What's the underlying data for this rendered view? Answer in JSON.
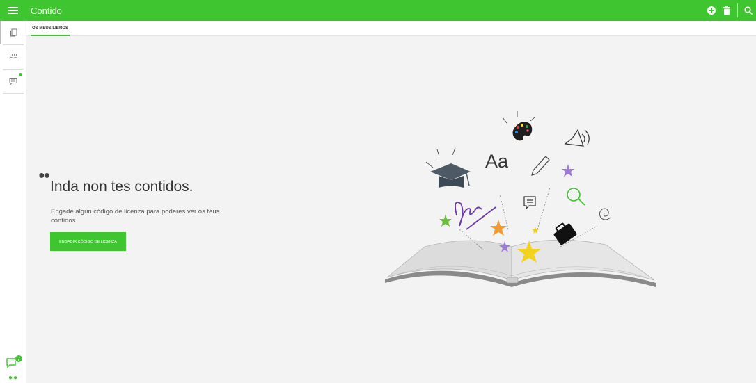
{
  "header": {
    "title": "Contido",
    "menu_icon": "menu-icon",
    "actions": [
      "add-icon",
      "trash-icon",
      "search-icon"
    ]
  },
  "tabs": [
    {
      "label": "OS MEUS LIBROS"
    }
  ],
  "sidebar": {
    "items": [
      {
        "icon": "books-icon"
      },
      {
        "icon": "groups-icon"
      },
      {
        "icon": "messages-icon"
      }
    ],
    "chat_badge": "7"
  },
  "empty_state": {
    "title": "Inda non tes contidos.",
    "description": "Engade algún código de licenza para poderes ver os teus contidos.",
    "button_label": "ENGADIR CÓDIGO DE LICENZA"
  },
  "illustration": {
    "letters": "Aa"
  },
  "colors": {
    "accent": "#3ec52f",
    "background": "#f3f3f3"
  }
}
